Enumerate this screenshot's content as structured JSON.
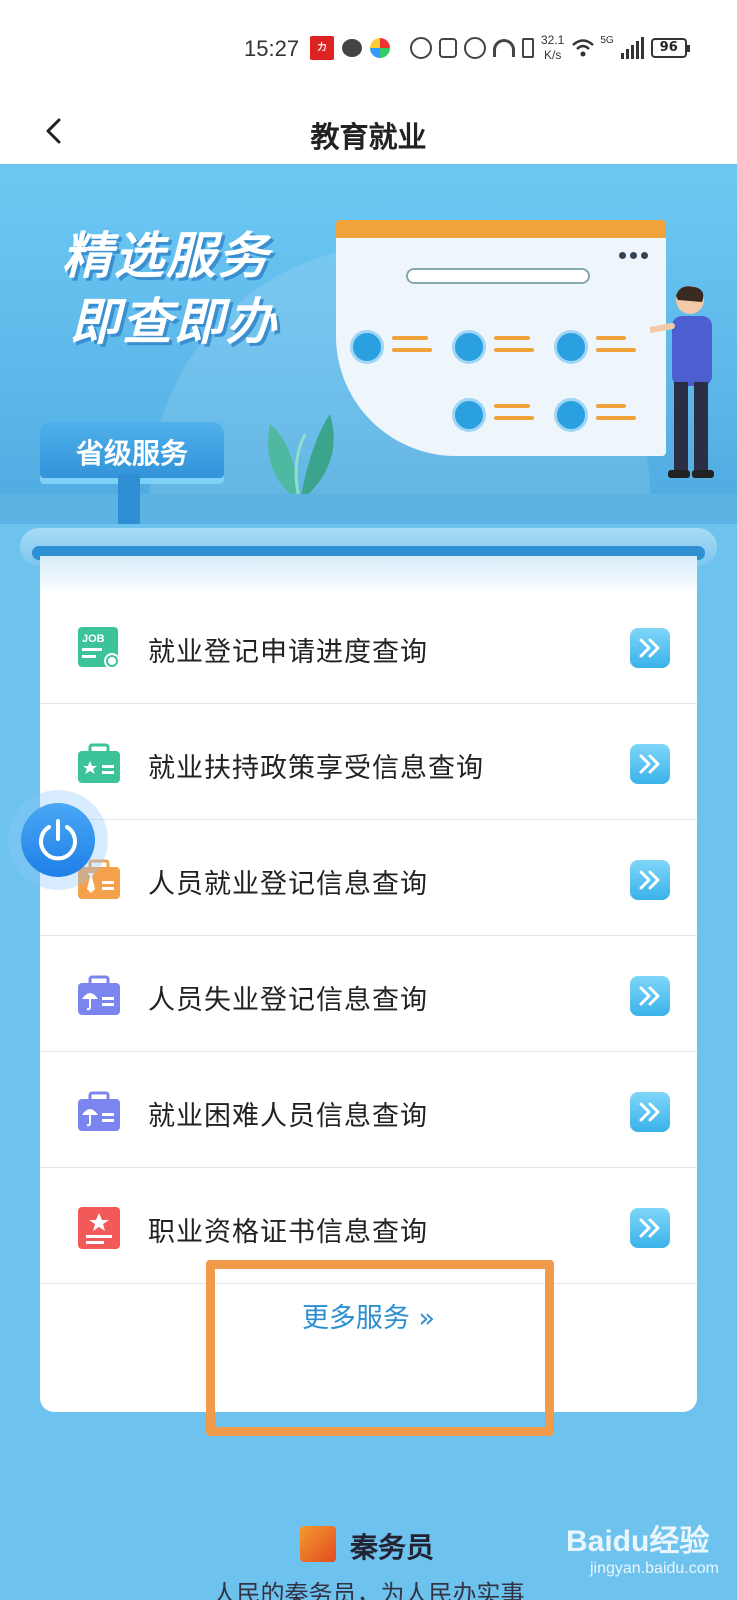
{
  "status_bar": {
    "time": "15:27",
    "speed_value": "32.1",
    "speed_unit": "K/s",
    "network": "5G",
    "battery": "96"
  },
  "header": {
    "title": "教育就业"
  },
  "banner": {
    "headline_line1": "精选服务",
    "headline_line2": "即查即办",
    "sign_label": "省级服务"
  },
  "services": [
    {
      "label": "就业登记申请进度查询",
      "icon": "job-icon",
      "color": "#3cc39a"
    },
    {
      "label": "就业扶持政策享受信息查询",
      "icon": "briefcase-star-icon",
      "color": "#3cc39a"
    },
    {
      "label": "人员就业登记信息查询",
      "icon": "briefcase-tie-icon",
      "color": "#f5a04a"
    },
    {
      "label": "人员失业登记信息查询",
      "icon": "briefcase-umbrella-icon",
      "color": "#7a85f0"
    },
    {
      "label": "就业困难人员信息查询",
      "icon": "briefcase-umbrella-icon",
      "color": "#7a85f0"
    },
    {
      "label": "职业资格证书信息查询",
      "icon": "certificate-icon",
      "color": "#f25a5a"
    }
  ],
  "more_services": "更多服务 »",
  "footer": {
    "brand": "秦务员",
    "slogan": "人民的秦务员，为人民办实事"
  },
  "watermark": {
    "main": "Baidu经验",
    "sub": "jingyan.baidu.com"
  },
  "colors": {
    "background": "#6ec3ee",
    "accent": "#2b8fd0",
    "highlight": "#f09a4a"
  }
}
